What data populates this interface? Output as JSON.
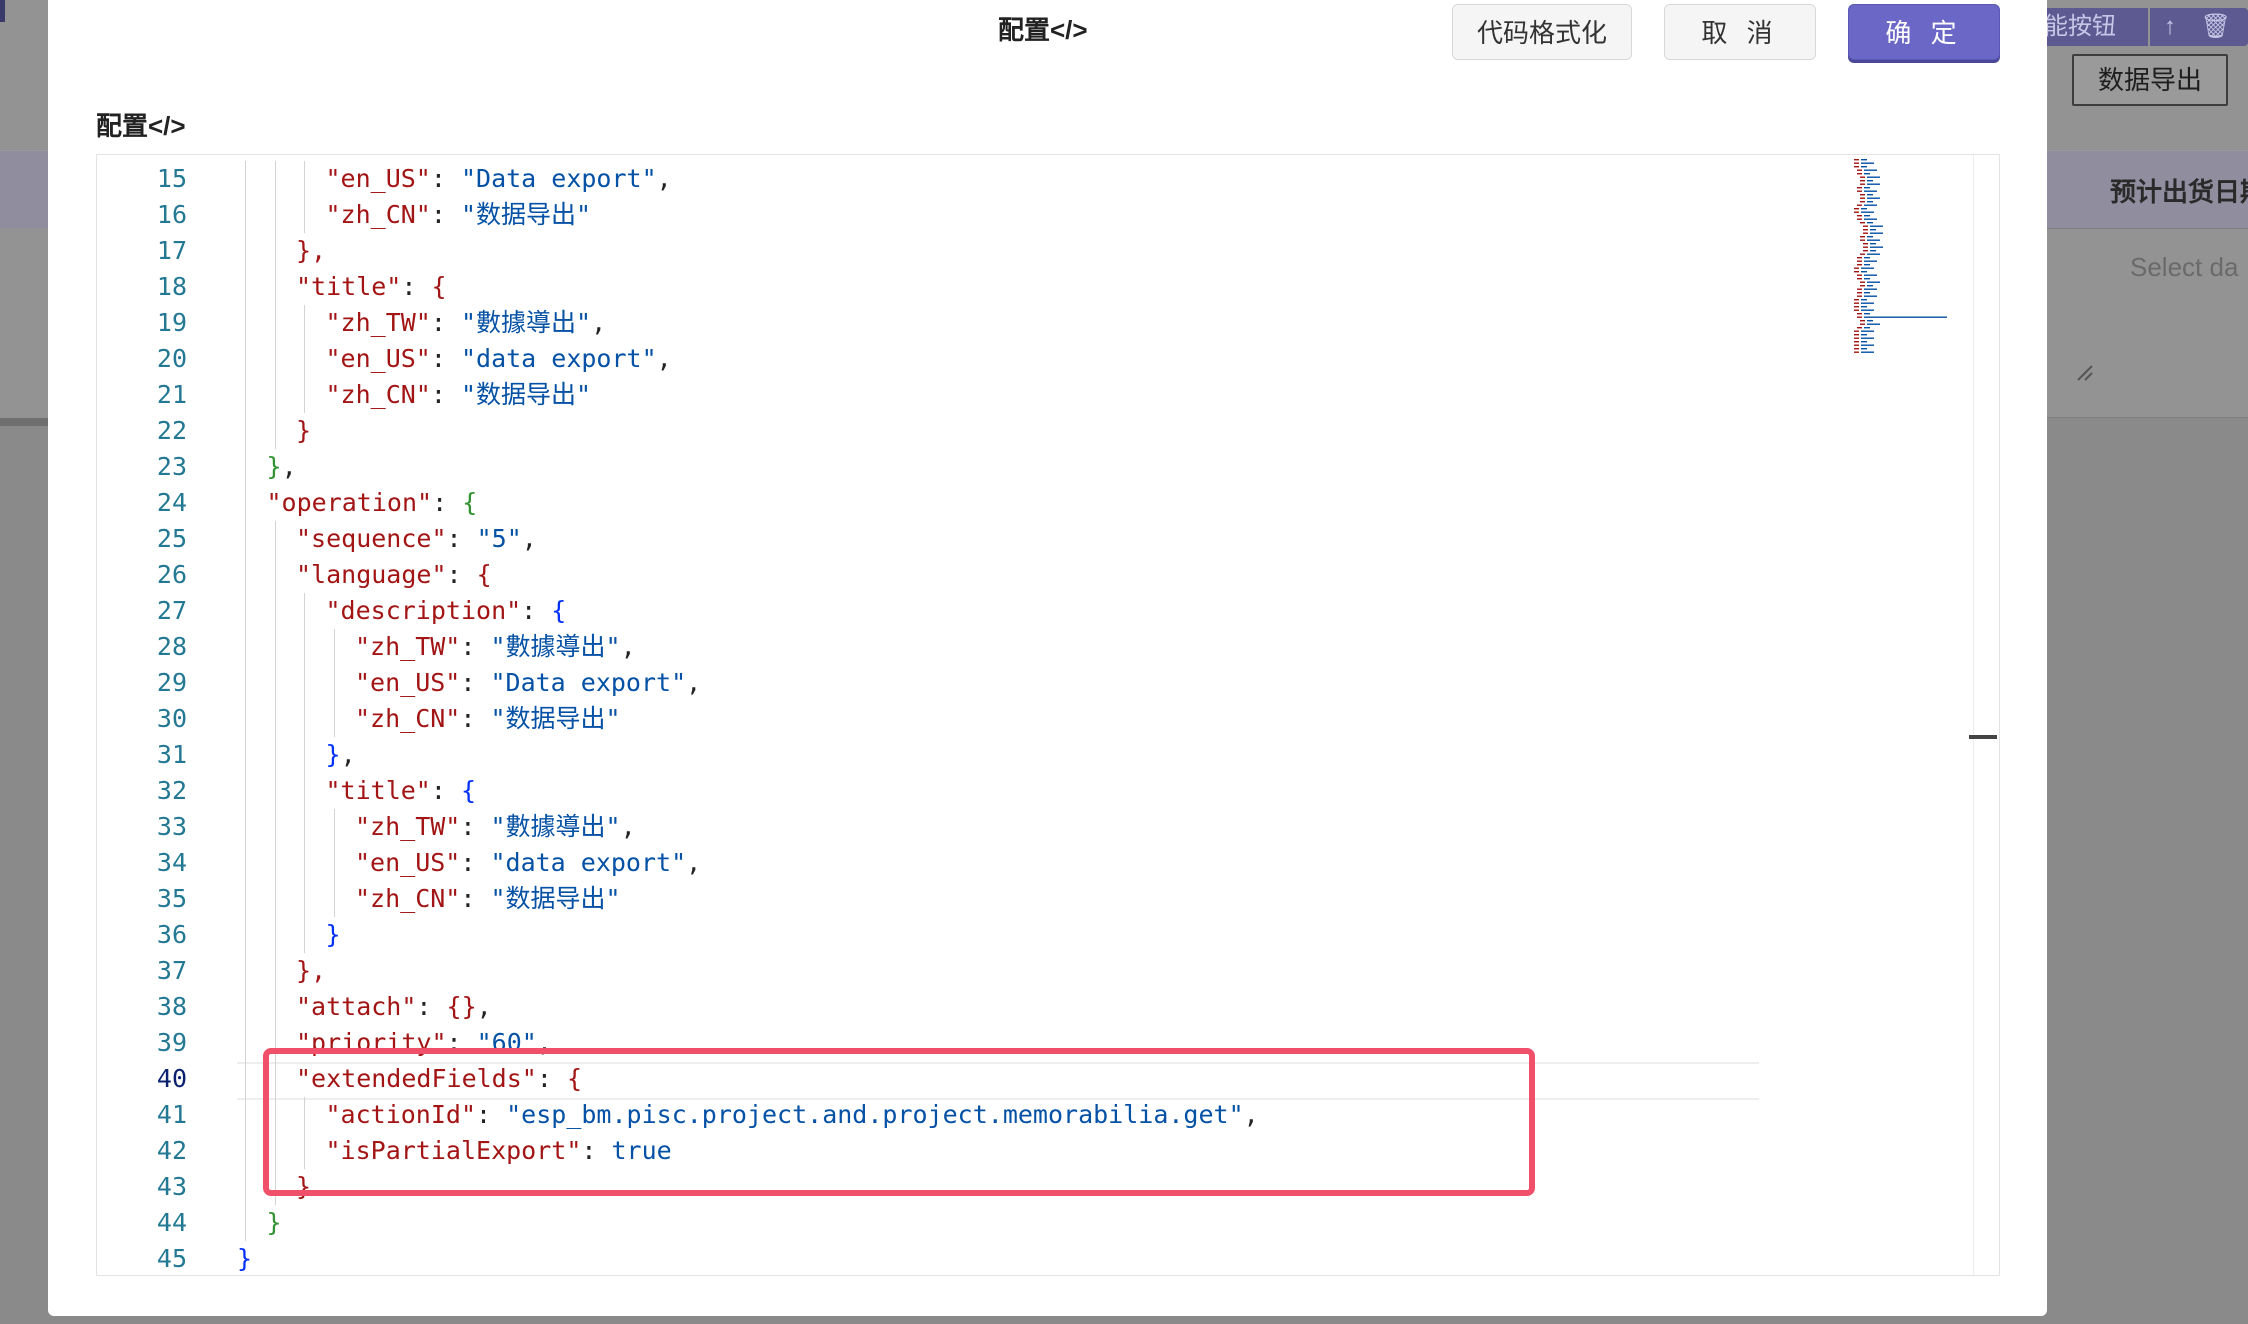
{
  "background": {
    "top_buttons": {
      "function_button": "能按钮",
      "icons_label": "↑ 🗑"
    },
    "export_button": "数据导出",
    "column_header": "预计出货日期",
    "date_placeholder": "Select da"
  },
  "modal": {
    "title": "配置</>",
    "buttons": {
      "format": "代码格式化",
      "cancel": "取 消",
      "ok": "确 定"
    },
    "section_label": "配置</>"
  },
  "editor": {
    "lines": [
      {
        "n": "15",
        "indent": 3,
        "tokens": [
          [
            "k",
            "\"en_US\""
          ],
          [
            "p",
            ": "
          ],
          [
            "s",
            "\"Data export\""
          ],
          [
            "p",
            ","
          ]
        ]
      },
      {
        "n": "16",
        "indent": 3,
        "tokens": [
          [
            "k",
            "\"zh_CN\""
          ],
          [
            "p",
            ": "
          ],
          [
            "s",
            "\"数据导出\""
          ]
        ]
      },
      {
        "n": "17",
        "indent": 2,
        "tokens": [
          [
            "k",
            "},"
          ]
        ]
      },
      {
        "n": "18",
        "indent": 2,
        "tokens": [
          [
            "k",
            "\"title\""
          ],
          [
            "p",
            ": "
          ],
          [
            "k",
            "{"
          ]
        ]
      },
      {
        "n": "19",
        "indent": 3,
        "tokens": [
          [
            "k",
            "\"zh_TW\""
          ],
          [
            "p",
            ": "
          ],
          [
            "s",
            "\"數據導出\""
          ],
          [
            "p",
            ","
          ]
        ]
      },
      {
        "n": "20",
        "indent": 3,
        "tokens": [
          [
            "k",
            "\"en_US\""
          ],
          [
            "p",
            ": "
          ],
          [
            "s",
            "\"data export\""
          ],
          [
            "p",
            ","
          ]
        ]
      },
      {
        "n": "21",
        "indent": 3,
        "tokens": [
          [
            "k",
            "\"zh_CN\""
          ],
          [
            "p",
            ": "
          ],
          [
            "s",
            "\"数据导出\""
          ]
        ]
      },
      {
        "n": "22",
        "indent": 2,
        "tokens": [
          [
            "k",
            "}"
          ]
        ]
      },
      {
        "n": "23",
        "indent": 1,
        "tokens": [
          [
            "g",
            "}"
          ],
          [
            "p",
            ","
          ]
        ]
      },
      {
        "n": "24",
        "indent": 1,
        "tokens": [
          [
            "k",
            "\"operation\""
          ],
          [
            "p",
            ": "
          ],
          [
            "g",
            "{"
          ]
        ]
      },
      {
        "n": "25",
        "indent": 2,
        "tokens": [
          [
            "k",
            "\"sequence\""
          ],
          [
            "p",
            ": "
          ],
          [
            "s",
            "\"5\""
          ],
          [
            "p",
            ","
          ]
        ]
      },
      {
        "n": "26",
        "indent": 2,
        "tokens": [
          [
            "k",
            "\"language\""
          ],
          [
            "p",
            ": "
          ],
          [
            "k",
            "{"
          ]
        ]
      },
      {
        "n": "27",
        "indent": 3,
        "tokens": [
          [
            "k",
            "\"description\""
          ],
          [
            "p",
            ": "
          ],
          [
            "b",
            "{"
          ]
        ]
      },
      {
        "n": "28",
        "indent": 4,
        "tokens": [
          [
            "k",
            "\"zh_TW\""
          ],
          [
            "p",
            ": "
          ],
          [
            "s",
            "\"數據導出\""
          ],
          [
            "p",
            ","
          ]
        ]
      },
      {
        "n": "29",
        "indent": 4,
        "tokens": [
          [
            "k",
            "\"en_US\""
          ],
          [
            "p",
            ": "
          ],
          [
            "s",
            "\"Data export\""
          ],
          [
            "p",
            ","
          ]
        ]
      },
      {
        "n": "30",
        "indent": 4,
        "tokens": [
          [
            "k",
            "\"zh_CN\""
          ],
          [
            "p",
            ": "
          ],
          [
            "s",
            "\"数据导出\""
          ]
        ]
      },
      {
        "n": "31",
        "indent": 3,
        "tokens": [
          [
            "b",
            "}"
          ],
          [
            "p",
            ","
          ]
        ]
      },
      {
        "n": "32",
        "indent": 3,
        "tokens": [
          [
            "k",
            "\"title\""
          ],
          [
            "p",
            ": "
          ],
          [
            "b",
            "{"
          ]
        ]
      },
      {
        "n": "33",
        "indent": 4,
        "tokens": [
          [
            "k",
            "\"zh_TW\""
          ],
          [
            "p",
            ": "
          ],
          [
            "s",
            "\"數據導出\""
          ],
          [
            "p",
            ","
          ]
        ]
      },
      {
        "n": "34",
        "indent": 4,
        "tokens": [
          [
            "k",
            "\"en_US\""
          ],
          [
            "p",
            ": "
          ],
          [
            "s",
            "\"data export\""
          ],
          [
            "p",
            ","
          ]
        ]
      },
      {
        "n": "35",
        "indent": 4,
        "tokens": [
          [
            "k",
            "\"zh_CN\""
          ],
          [
            "p",
            ": "
          ],
          [
            "s",
            "\"数据导出\""
          ]
        ]
      },
      {
        "n": "36",
        "indent": 3,
        "tokens": [
          [
            "b",
            "}"
          ]
        ]
      },
      {
        "n": "37",
        "indent": 2,
        "tokens": [
          [
            "k",
            "},"
          ]
        ]
      },
      {
        "n": "38",
        "indent": 2,
        "tokens": [
          [
            "k",
            "\"attach\""
          ],
          [
            "p",
            ": "
          ],
          [
            "k",
            "{}"
          ],
          [
            "p",
            ","
          ]
        ]
      },
      {
        "n": "39",
        "indent": 2,
        "tokens": [
          [
            "k",
            "\"priority\""
          ],
          [
            "p",
            ": "
          ],
          [
            "s",
            "\"60\""
          ],
          [
            "p",
            ","
          ]
        ]
      },
      {
        "n": "40",
        "indent": 2,
        "tokens": [
          [
            "k",
            "\"extendedFields\""
          ],
          [
            "p",
            ": "
          ],
          [
            "k",
            "{"
          ]
        ]
      },
      {
        "n": "41",
        "indent": 3,
        "tokens": [
          [
            "k",
            "\"actionId\""
          ],
          [
            "p",
            ": "
          ],
          [
            "s",
            "\"esp_bm.pisc.project.and.project.memorabilia.get\""
          ],
          [
            "p",
            ","
          ]
        ]
      },
      {
        "n": "42",
        "indent": 3,
        "tokens": [
          [
            "k",
            "\"isPartialExport\""
          ],
          [
            "p",
            ": "
          ],
          [
            "s",
            "true"
          ]
        ]
      },
      {
        "n": "43",
        "indent": 2,
        "tokens": [
          [
            "k",
            "}"
          ]
        ]
      },
      {
        "n": "44",
        "indent": 1,
        "tokens": [
          [
            "g",
            "}"
          ]
        ]
      },
      {
        "n": "45",
        "indent": 0,
        "tokens": [
          [
            "b",
            "}"
          ]
        ]
      }
    ],
    "active_line": "40"
  },
  "colors": {
    "accent": "#6a67c6",
    "highlight_border": "#f0506a",
    "json_key": "#a31515",
    "json_string": "#0451a5",
    "bracket_blue": "#0431fa",
    "bracket_green": "#319331",
    "line_number": "#237893"
  },
  "icons": [
    "arrow-up-icon",
    "trash-icon",
    "resize-handle-icon"
  ]
}
